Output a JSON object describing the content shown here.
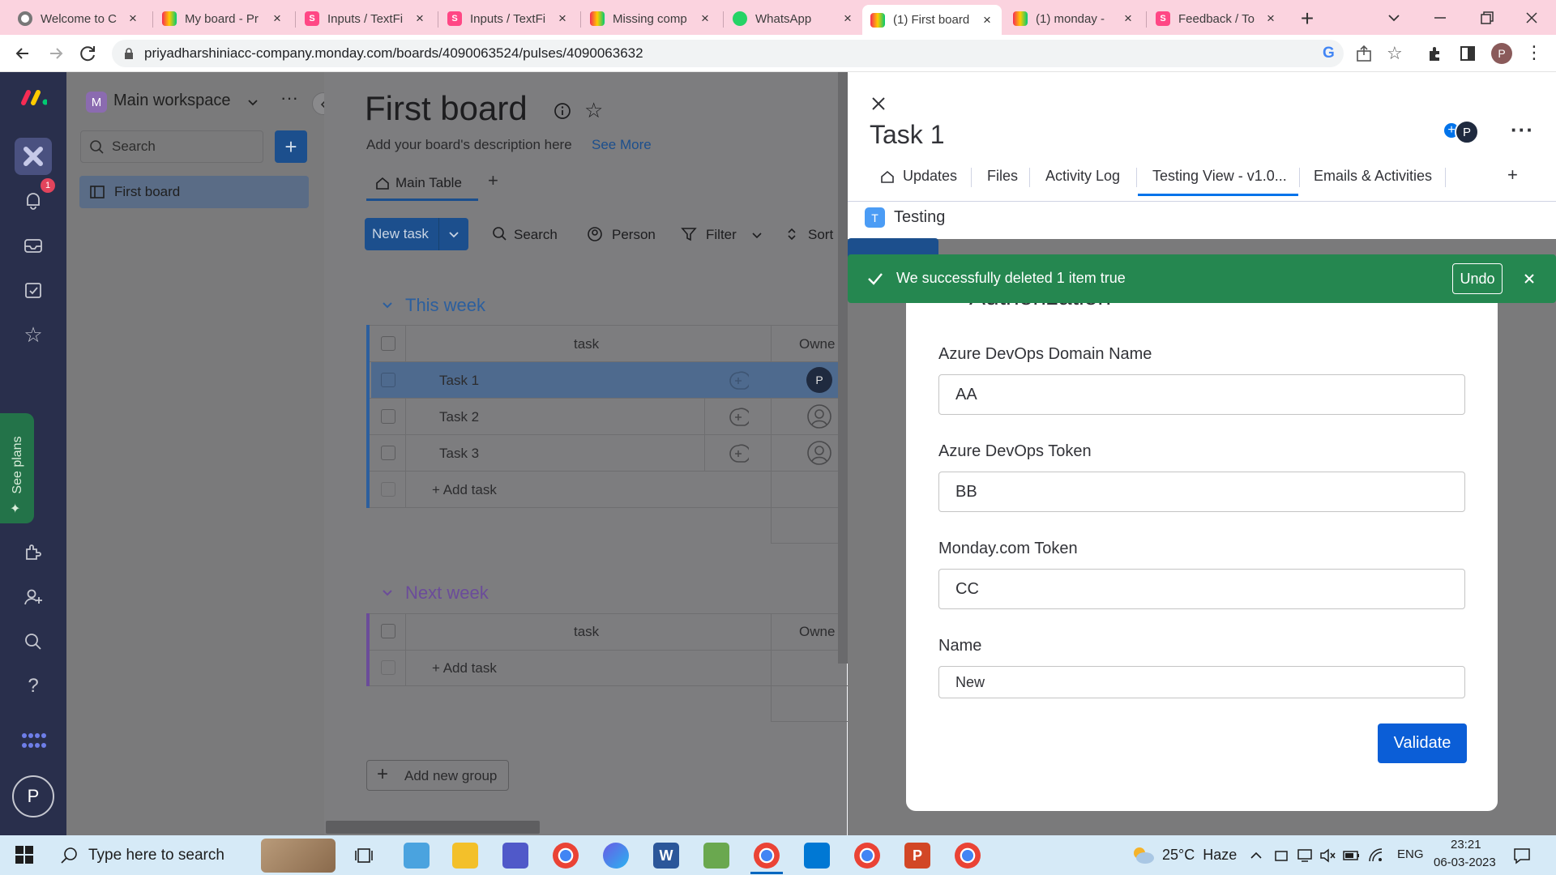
{
  "browser": {
    "tabs": [
      {
        "title": "Welcome to C",
        "icon": "chrome-icon"
      },
      {
        "title": "My board - Pr",
        "icon": "monday-icon"
      },
      {
        "title": "Inputs / TextFi",
        "icon": "storybook-icon"
      },
      {
        "title": "Inputs / TextFi",
        "icon": "storybook-icon"
      },
      {
        "title": "Missing comp",
        "icon": "monday-icon"
      },
      {
        "title": "WhatsApp",
        "icon": "whatsapp-icon"
      },
      {
        "title": "(1) First board",
        "icon": "monday-icon"
      },
      {
        "title": "(1) monday - ",
        "icon": "monday-icon"
      },
      {
        "title": "Feedback / To",
        "icon": "storybook-icon"
      }
    ],
    "url": "priyadharshiniacc-company.monday.com/boards/4090063524/pulses/4090063632",
    "profile_initial": "P"
  },
  "rail": {
    "notification_count": "1",
    "see_plans": "See plans",
    "user_initial": "P"
  },
  "sidebar": {
    "workspace_initial": "M",
    "workspace_name": "Main workspace",
    "search_placeholder": "Search",
    "items": [
      {
        "label": "First board"
      }
    ]
  },
  "board": {
    "title": "First board",
    "description": "Add your board's description here",
    "see_more": "See More",
    "view_tab": "Main Table",
    "new_task": "New task",
    "toolbar": {
      "search": "Search",
      "person": "Person",
      "filter": "Filter",
      "sort": "Sort"
    },
    "groups": [
      {
        "name": "This week",
        "color": "#2c5f9e",
        "column_task": "task",
        "column_owner": "Owne",
        "rows": [
          {
            "name": "Task 1",
            "owner": "P"
          },
          {
            "name": "Task 2",
            "owner": ""
          },
          {
            "name": "Task 3",
            "owner": ""
          }
        ],
        "add_task": "+ Add task"
      },
      {
        "name": "Next week",
        "color": "#6b4c9a",
        "column_task": "task",
        "column_owner": "Owne",
        "rows": [],
        "add_task": "+ Add task"
      }
    ],
    "add_group": "Add new group"
  },
  "item_panel": {
    "title": "Task 1",
    "avatar_initial": "P",
    "tabs": [
      "Updates",
      "Files",
      "Activity Log",
      "Testing View - v1.0...",
      "Emails & Activities"
    ],
    "active_tab": "Testing View - v1.0...",
    "app_badge": "T",
    "app_name": "Testing",
    "toast": {
      "message": "We successfully deleted 1 item true",
      "undo": "Undo"
    },
    "modal": {
      "heading": "Authorization",
      "fields": [
        {
          "label": "Azure DevOps Domain Name",
          "value": "AA"
        },
        {
          "label": "Azure DevOps Token",
          "value": "BB"
        },
        {
          "label": "Monday.com Token",
          "value": "CC"
        },
        {
          "label": "Name",
          "value": "New"
        }
      ],
      "validate": "Validate"
    }
  },
  "taskbar": {
    "search_placeholder": "Type here to search",
    "weather": "25°C  Haze",
    "lang": "ENG",
    "time": "23:21",
    "date": "06-03-2023"
  },
  "colors": {
    "accent": "#0073ea",
    "toast": "#258750",
    "validate": "#0b5ed7",
    "rail": "#292f4c"
  }
}
